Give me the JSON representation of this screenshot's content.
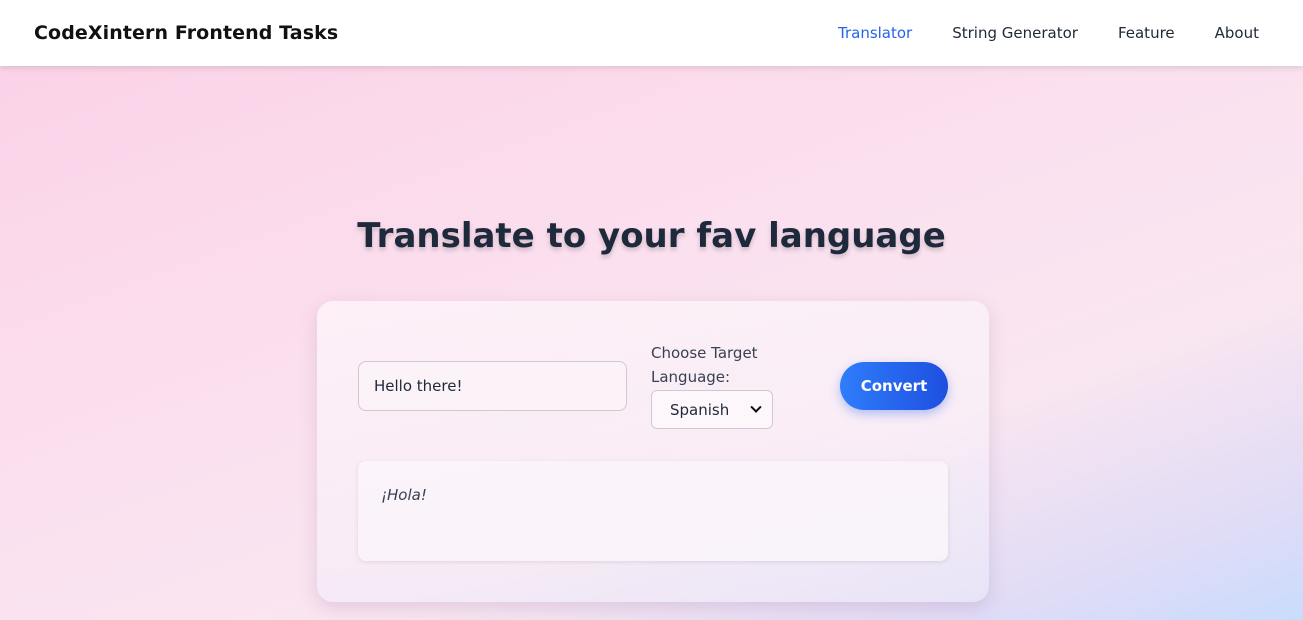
{
  "navbar": {
    "brand": "CodeXintern Frontend Tasks",
    "links": [
      {
        "label": "Translator",
        "active": true
      },
      {
        "label": "String Generator",
        "active": false
      },
      {
        "label": "Feature",
        "active": false
      },
      {
        "label": "About",
        "active": false
      }
    ],
    "active_color": "#2563eb"
  },
  "main": {
    "title": "Translate to your fav language"
  },
  "translator": {
    "input_value": "Hello there!",
    "language_label": "Choose Target Language:",
    "selected_language": "Spanish",
    "convert_label": "Convert",
    "output_text": "¡Hola!",
    "button_color": "#2563eb"
  }
}
